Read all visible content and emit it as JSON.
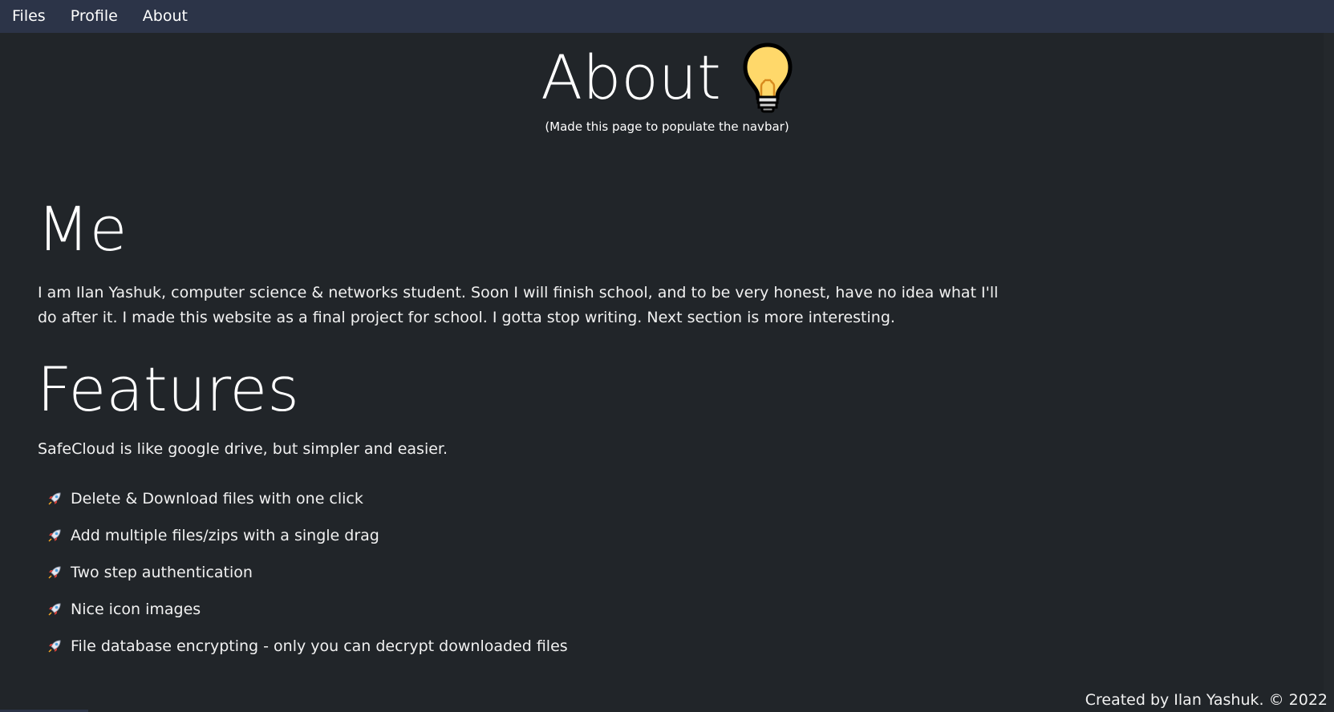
{
  "navbar": {
    "links": [
      {
        "label": "Files"
      },
      {
        "label": "Profile"
      },
      {
        "label": "About"
      }
    ]
  },
  "hero": {
    "title": "About",
    "icon": "lightbulb-icon",
    "subtitle": "(Made this page to populate the navbar)"
  },
  "me": {
    "title": "Me",
    "text": "I am Ilan Yashuk, computer science & networks student. Soon I will finish school, and to be very honest, have no idea what I'll do after it. I made this website as a final project for school. I gotta stop writing. Next section is more interesting."
  },
  "features": {
    "title": "Features",
    "intro": "SafeCloud is like google drive, but simpler and easier.",
    "item_icon": "rocket-icon",
    "items": [
      {
        "label": "Delete & Download files with one click"
      },
      {
        "label": "Add multiple files/zips with a single drag"
      },
      {
        "label": "Two step authentication"
      },
      {
        "label": "Nice icon images"
      },
      {
        "label": "File database encrypting - only you can decrypt downloaded files"
      }
    ]
  },
  "footer": {
    "text": "Created by Ilan Yashuk. © 2022"
  },
  "colors": {
    "background": "#212529",
    "navbar": "#2c3448",
    "text": "#ffffff",
    "bulb": "#ffd86a"
  }
}
